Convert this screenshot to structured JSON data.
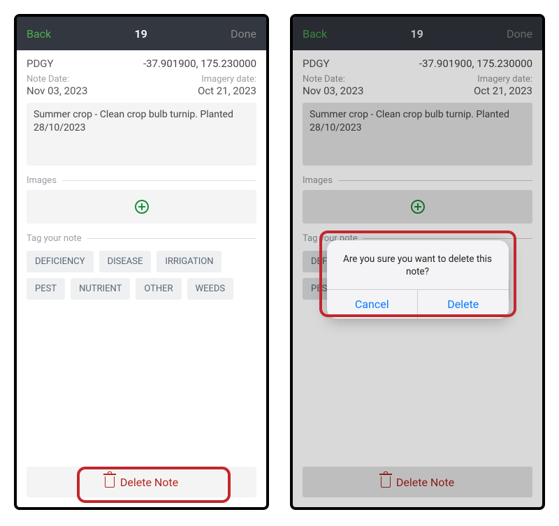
{
  "nav": {
    "back": "Back",
    "title": "19",
    "done": "Done"
  },
  "header": {
    "code": "PDGY",
    "coords": "-37.901900, 175.230000",
    "noteDateLabel": "Note Date:",
    "noteDate": "Nov 03, 2023",
    "imageryDateLabel": "Imagery date:",
    "imageryDate": "Oct 21, 2023"
  },
  "note": {
    "text": "Summer crop - Clean crop bulb turnip. Planted 28/10/2023"
  },
  "sections": {
    "images": "Images",
    "tags": "Tag your note"
  },
  "tags": [
    "DEFICIENCY",
    "DISEASE",
    "IRRIGATION",
    "PEST",
    "NUTRIENT",
    "OTHER",
    "WEEDS"
  ],
  "delete": {
    "label": "Delete Note"
  },
  "dialog": {
    "message": "Are you sure you want to delete this note?",
    "cancel": "Cancel",
    "confirm": "Delete"
  }
}
